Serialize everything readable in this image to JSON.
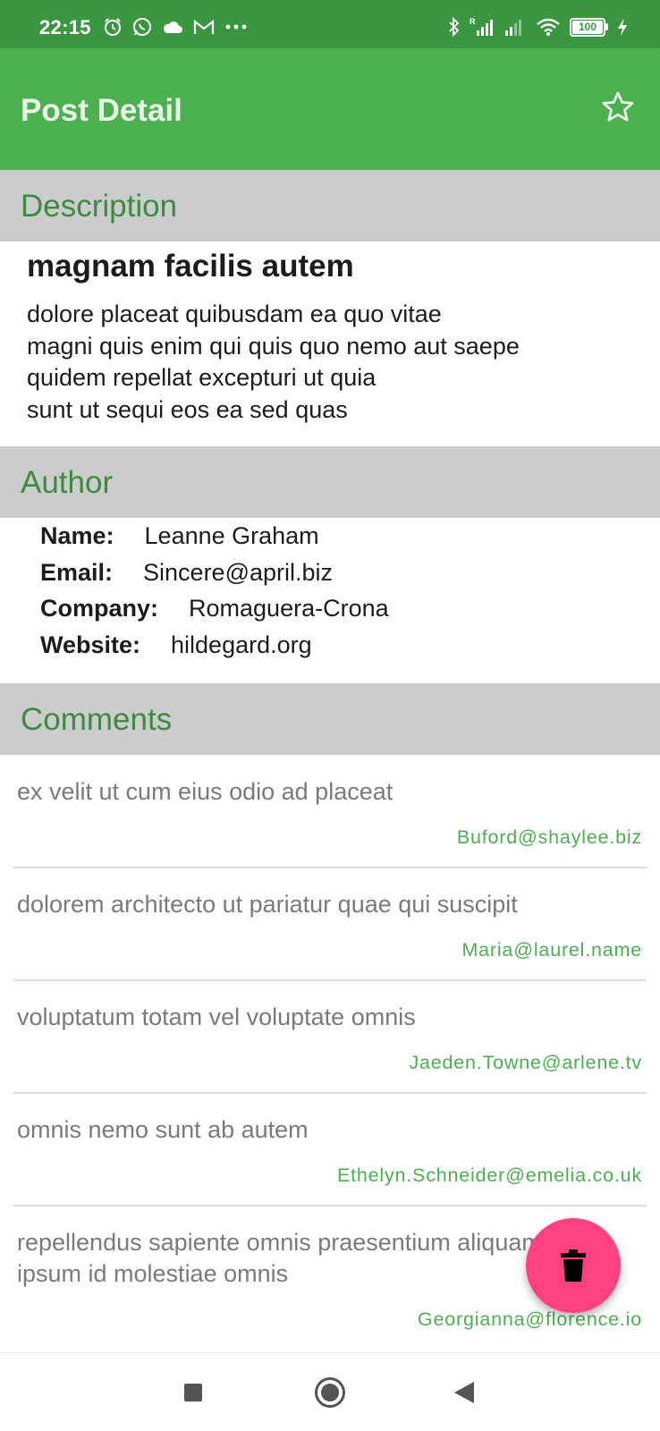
{
  "status_bar": {
    "time": "22:15",
    "left_icons": [
      "alarm-icon",
      "whatsapp-icon",
      "cloud-icon",
      "gmail-icon",
      "more-dots-icon"
    ],
    "right_icons": [
      "bluetooth-icon",
      "signal-r-icon",
      "signal-icon",
      "wifi-icon",
      "battery-icon",
      "charging-icon"
    ],
    "battery_level": "100"
  },
  "app_bar": {
    "title": "Post Detail",
    "action_icon": "star-outline-icon"
  },
  "description": {
    "header": "Description",
    "title": "magnam facilis autem",
    "body": "dolore placeat quibusdam ea quo vitae\nmagni quis enim qui quis quo nemo aut saepe\nquidem repellat excepturi ut quia\nsunt ut sequi eos ea sed quas"
  },
  "author": {
    "header": "Author",
    "rows": [
      {
        "label": "Name:",
        "value": "Leanne Graham"
      },
      {
        "label": "Email:",
        "value": "Sincere@april.biz"
      },
      {
        "label": "Company:",
        "value": "Romaguera-Crona"
      },
      {
        "label": "Website:",
        "value": "hildegard.org"
      }
    ]
  },
  "comments": {
    "header": "Comments",
    "items": [
      {
        "text": "ex velit ut cum eius odio ad placeat",
        "email": "Buford@shaylee.biz"
      },
      {
        "text": "dolorem architecto ut pariatur quae qui suscipit",
        "email": "Maria@laurel.name"
      },
      {
        "text": "voluptatum totam vel voluptate omnis",
        "email": "Jaeden.Towne@arlene.tv"
      },
      {
        "text": "omnis nemo sunt ab autem",
        "email": "Ethelyn.Schneider@emelia.co.uk"
      },
      {
        "text": "repellendus sapiente omnis praesentium aliquam\nipsum id molestiae omnis",
        "email": "Georgianna@florence.io"
      }
    ]
  },
  "fab": {
    "icon": "trash-icon"
  },
  "nav_bar": {
    "icons": [
      "recents-square-icon",
      "home-circle-icon",
      "back-triangle-icon"
    ]
  },
  "colors": {
    "status_bar": "#3a9640",
    "app_bar": "#4caf50",
    "section_header_bg": "#cccccc",
    "section_header_text": "#3b8c3f",
    "comment_email": "#4caf50",
    "fab": "#ff4081"
  }
}
